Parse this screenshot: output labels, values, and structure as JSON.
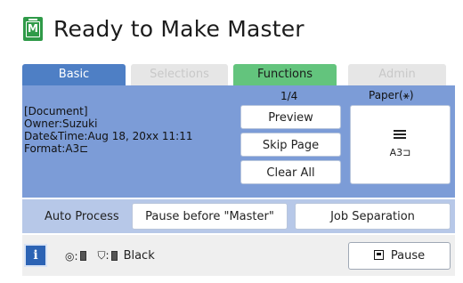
{
  "title": "Ready to Make Master",
  "tabs": {
    "basic": "Basic",
    "selections": "Selections",
    "functions": "Functions",
    "admin": "Admin"
  },
  "document": {
    "heading": "[Document]",
    "owner": "Owner:Suzuki",
    "datetime": "Date&Time:Aug 18, 20xx 11:11",
    "format": "Format:A3⊏"
  },
  "page_counter": "1/4",
  "paper_label": "Paper(⚹)",
  "buttons": {
    "preview": "Preview",
    "skip_page": "Skip Page",
    "clear_all": "Clear All",
    "paper_size": "A3⊐"
  },
  "auto_process": {
    "label": "Auto Process",
    "pause_before_master": "Pause before \"Master\"",
    "job_separation": "Job Separation"
  },
  "status": {
    "info_icon_label": "i",
    "ink_color": "Black",
    "pause_label": "Pause"
  },
  "colors": {
    "title_icon": "#2f9a48",
    "tab_basic": "#4e7fc5",
    "tab_functions": "#63c47d",
    "panel": "#7c9cd7",
    "auto_row": "#b7c8e8",
    "info_button": "#2c63b4"
  }
}
